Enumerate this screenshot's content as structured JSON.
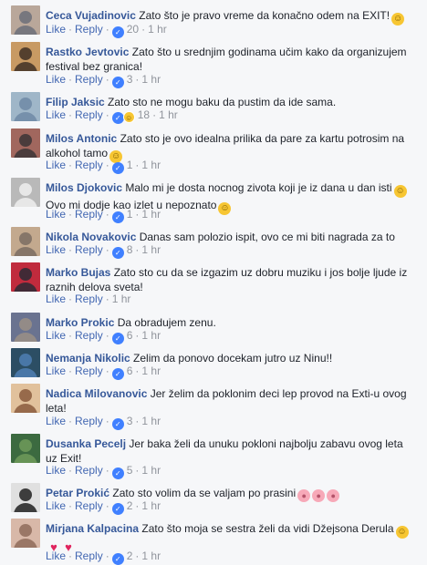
{
  "labels": {
    "like": "Like",
    "reply": "Reply",
    "dot": "·"
  },
  "colors": {
    "author": "#365899",
    "link": "#4267b2",
    "meta": "#90949c",
    "text": "#1d2129",
    "like_blue": "#4080ff"
  },
  "comments": [
    {
      "author": "Ceca Vujadinovic",
      "text": "Zato što je pravo vreme da konačno odem na EXIT!",
      "emoji": "smile",
      "likes": "20",
      "time": "1 hr",
      "reactions": [
        "like"
      ]
    },
    {
      "author": "Rastko Jevtovic",
      "text": "Zato što u srednjim godinama učim kako da organizujem festival bez granica!",
      "emoji": "",
      "likes": "3",
      "time": "1 hr",
      "reactions": [
        "like"
      ]
    },
    {
      "author": "Filip Jaksic",
      "text": "Zato sto ne mogu baku da pustim da ide sama.",
      "emoji": "",
      "likes": "18",
      "time": "1 hr",
      "reactions": [
        "like",
        "haha"
      ]
    },
    {
      "author": "Milos Antonic",
      "text": "Zato sto je ovo idealna prilika da pare za kartu potrosim na alkohol tamo",
      "emoji": "smile",
      "likes": "1",
      "time": "1 hr",
      "reactions": [
        "like"
      ]
    },
    {
      "author": "Milos Djokovic",
      "text": "Malo mi je dosta nocnog zivota koji je iz dana u dan isti",
      "text2": "Ovo mi dodje kao izlet u nepoznato",
      "emoji": "smile",
      "likes": "1",
      "time": "1 hr",
      "reactions": [
        "like"
      ]
    },
    {
      "author": "Nikola Novakovic",
      "text": "Danas sam polozio ispit, ovo ce mi biti nagrada za to",
      "emoji": "",
      "likes": "8",
      "time": "1 hr",
      "reactions": [
        "like"
      ]
    },
    {
      "author": "Marko Bujas",
      "text": "Zato sto cu da se izgazim uz dobru muziku i jos bolje ljude iz raznih delova sveta!",
      "emoji": "",
      "likes": "",
      "time": "1 hr",
      "reactions": []
    },
    {
      "author": "Marko Prokic",
      "text": "Da obradujem zenu.",
      "emoji": "",
      "likes": "6",
      "time": "1 hr",
      "reactions": [
        "like"
      ]
    },
    {
      "author": "Nemanja Nikolic",
      "text": "Zelim da ponovo docekam jutro uz Ninu!!",
      "emoji": "",
      "likes": "6",
      "time": "1 hr",
      "reactions": [
        "like"
      ]
    },
    {
      "author": "Nadica Milovanovic",
      "text": "Jer želim da poklonim deci lep provod na Exti-u ovog leta!",
      "emoji": "",
      "likes": "3",
      "time": "1 hr",
      "reactions": [
        "like"
      ]
    },
    {
      "author": "Dusanka Pecelj",
      "text": "Jer baka želi da unuku pokloni najbolju zabavu ovog leta uz Exit!",
      "emoji": "",
      "likes": "5",
      "time": "1 hr",
      "reactions": [
        "like"
      ]
    },
    {
      "author": "Petar Prokić",
      "text": "Zato sto volim da se valjam po prasini",
      "emoji": "pigs",
      "likes": "2",
      "time": "1 hr",
      "reactions": [
        "like"
      ]
    },
    {
      "author": "Mirjana Kalpacina",
      "text": "Zato što moja se sestra želi da vidi Džejsona Derula",
      "emoji": "smile-flame",
      "likes": "2",
      "time": "1 hr",
      "reactions": [
        "like"
      ]
    }
  ]
}
